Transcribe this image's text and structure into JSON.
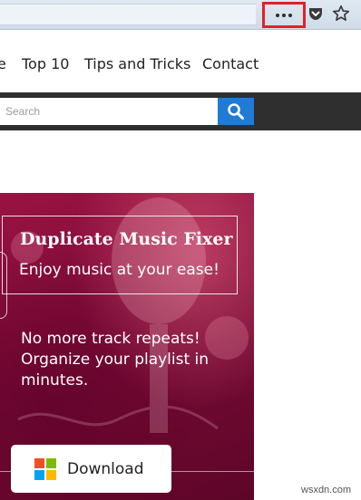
{
  "toolbar": {
    "menu_icon": "more-horizontal-icon",
    "pocket_icon": "pocket-icon",
    "bookmark_icon": "star-icon",
    "highlight_color": "#e0222a"
  },
  "nav": {
    "items": [
      {
        "label": "e"
      },
      {
        "label": "Top 10"
      },
      {
        "label": "Tips and Tricks"
      },
      {
        "label": "Contact"
      }
    ]
  },
  "search": {
    "placeholder": "Search",
    "button_icon": "search-icon",
    "button_color": "#1f7bd6"
  },
  "banner": {
    "title": "Duplicate Music Fixer",
    "subtitle": "Enjoy music at your ease!",
    "copy": "No more track repeats! Organize your playlist in minutes.",
    "download_label": "Download",
    "download_icon": "windows-icon",
    "background_color": "#7a0a35"
  },
  "watermark": "wsxdn.com"
}
